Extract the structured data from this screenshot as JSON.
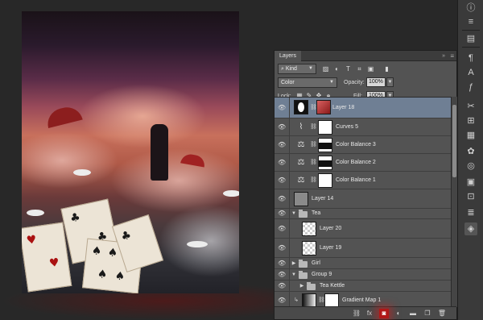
{
  "panel": {
    "tab_label": "Layers",
    "collapse_glyph": "»",
    "menu_glyph": "≡",
    "filter_kind": "Kind",
    "blend_mode": "Color",
    "opacity_label": "Opacity:",
    "opacity_value": "100%",
    "lock_label": "Lock:",
    "fill_label": "Fill:",
    "fill_value": "100%"
  },
  "layers": [
    {
      "name": "Layer 18",
      "type": "masked",
      "selected": true
    },
    {
      "name": "Curves 5",
      "type": "curves"
    },
    {
      "name": "Color Balance 3",
      "type": "balance"
    },
    {
      "name": "Color Balance 2",
      "type": "balance"
    },
    {
      "name": "Color Balance 1",
      "type": "balance"
    },
    {
      "name": "Layer 14",
      "type": "pixel"
    },
    {
      "name": "Tea",
      "type": "group"
    },
    {
      "name": "Layer 20",
      "type": "pixel"
    },
    {
      "name": "Layer 19",
      "type": "pixel"
    },
    {
      "name": "Girl",
      "type": "group"
    },
    {
      "name": "Group 9",
      "type": "group"
    },
    {
      "name": "Tea Kettle",
      "type": "group"
    },
    {
      "name": "Gradient Map 1",
      "type": "gradient"
    }
  ],
  "icons": {
    "eye": "eye-icon",
    "link": "link-icon",
    "fx": "fx-icon",
    "mask": "add-mask-icon",
    "adjust": "adjustment-icon",
    "new_group": "new-group-icon",
    "new_layer": "new-layer-icon",
    "trash": "trash-icon"
  },
  "colors": {
    "highlight": "#b01818",
    "selected_row": "#6f7f94"
  }
}
